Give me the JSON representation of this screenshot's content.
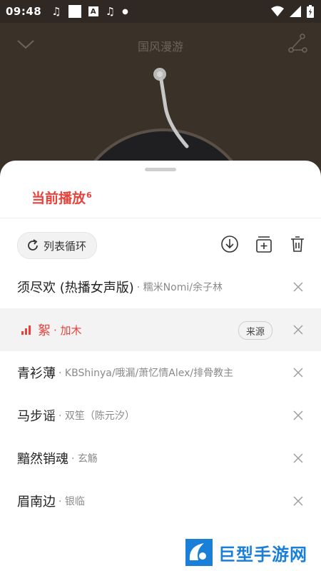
{
  "status_bar": {
    "time": "09:48",
    "icons": [
      "music-note-icon",
      "square-icon",
      "a-icon",
      "music-note-icon",
      "dot-icon"
    ]
  },
  "player": {
    "title": "国风漫游"
  },
  "playlist": {
    "title": "当前播放",
    "count": "6",
    "loop_label": "列表循环",
    "source_label": "来源",
    "songs": [
      {
        "title": "须尽欢 (热播女声版)",
        "artist": "· 糯米Nomi/余子林"
      },
      {
        "title": "絮",
        "artist": "· 加木"
      },
      {
        "title": "青衫薄",
        "artist": "· KBShinya/哦漏/萧忆情Alex/排骨教主"
      },
      {
        "title": "马步谣",
        "artist": "· 双笙（陈元汐）"
      },
      {
        "title": "黯然销魂",
        "artist": "· 玄觞"
      },
      {
        "title": "眉南边",
        "artist": "· 银临"
      }
    ]
  },
  "watermark": {
    "text": "巨型手游网"
  },
  "colors": {
    "accent": "#e8423c",
    "background": "#3a3129"
  }
}
